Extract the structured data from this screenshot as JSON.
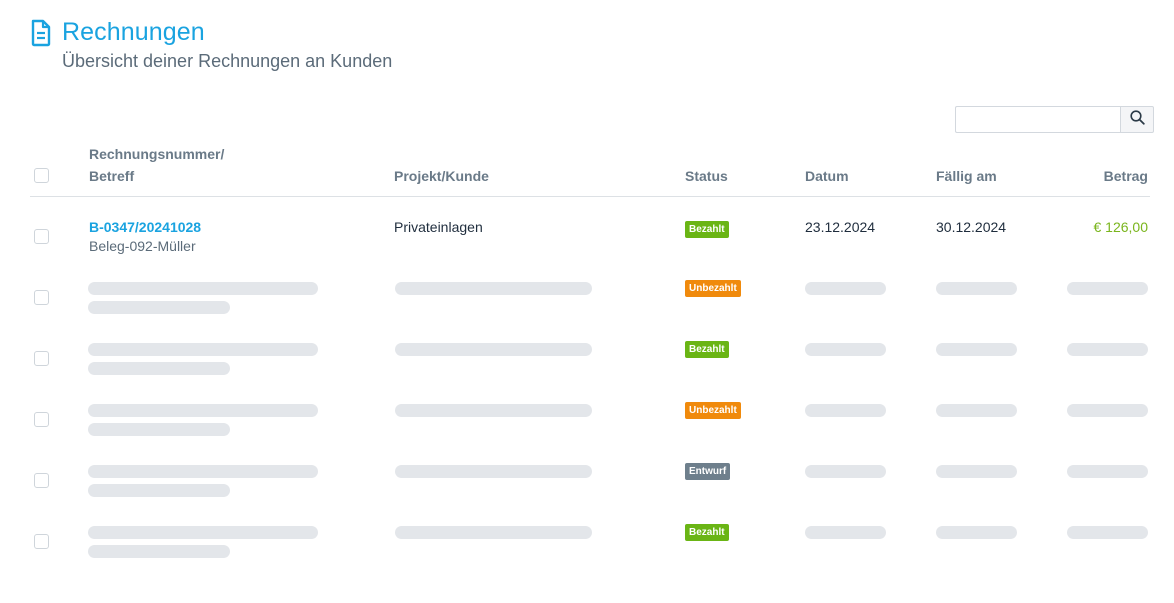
{
  "header": {
    "title": "Rechnungen",
    "subtitle": "Übersicht deiner Rechnungen an Kunden"
  },
  "search": {
    "value": "",
    "placeholder": ""
  },
  "table": {
    "columns": {
      "number_line1": "Rechnungsnummer/",
      "number_line2": "Betreff",
      "project": "Projekt/Kunde",
      "status": "Status",
      "date": "Datum",
      "due": "Fällig am",
      "amount": "Betrag"
    },
    "rows": [
      {
        "number": "B-0347/20241028",
        "subject": "Beleg-092-Müller",
        "project": "Privateinlagen",
        "status": "Bezahlt",
        "date": "23.12.2024",
        "due": "30.12.2024",
        "amount": "€ 126,00"
      },
      {
        "status": "Unbezahlt"
      },
      {
        "status": "Bezahlt"
      },
      {
        "status": "Unbezahlt"
      },
      {
        "status": "Entwurf"
      },
      {
        "status": "Bezahlt"
      }
    ]
  },
  "colors": {
    "accent": "#1aa3e0",
    "paid": "#6ab515",
    "unpaid": "#f08a0c",
    "draft": "#6e7f8c",
    "amount": "#7ab51d"
  },
  "icons": {
    "title": "document-icon",
    "search": "search-icon"
  }
}
